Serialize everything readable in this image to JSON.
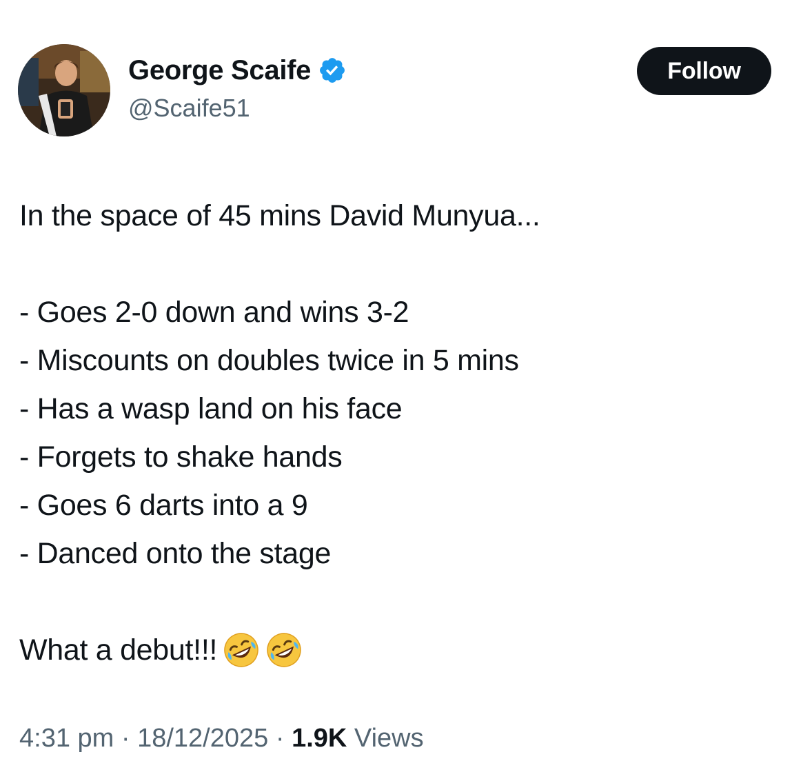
{
  "author": {
    "display_name": "George Scaife",
    "handle": "@Scaife51",
    "verified": true,
    "verified_color": "#1d9bf0"
  },
  "follow_button": {
    "label": "Follow"
  },
  "tweet": {
    "intro": "In the space of 45 mins David Munyua...",
    "items": [
      "- Goes 2-0 down and wins 3-2",
      "- Miscounts on doubles twice in 5 mins",
      "- Has a wasp land on his face",
      "- Forgets to shake hands",
      "- Goes 6 darts into a 9",
      "- Danced onto the stage"
    ],
    "closing": "What a debut!!!",
    "closing_emojis": [
      "rolling-on-floor-laughing-emoji",
      "rolling-on-floor-laughing-emoji"
    ]
  },
  "meta": {
    "time": "4:31 pm",
    "separator": "·",
    "date": "18/12/2025",
    "views_count": "1.9K",
    "views_label": "Views"
  }
}
